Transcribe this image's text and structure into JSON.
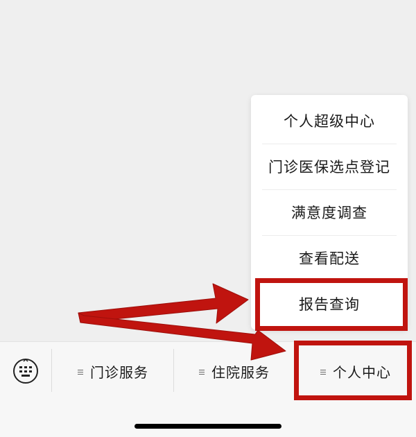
{
  "popup_menu": {
    "items": [
      {
        "label": "个人超级中心"
      },
      {
        "label": "门诊医保选点登记"
      },
      {
        "label": "满意度调查"
      },
      {
        "label": "查看配送"
      },
      {
        "label": "报告查询"
      }
    ]
  },
  "bottom_bar": {
    "keyboard_icon": "keyboard-icon",
    "tabs": [
      {
        "label": "门诊服务",
        "icon": "menu-lines-icon"
      },
      {
        "label": "住院服务",
        "icon": "menu-lines-icon"
      },
      {
        "label": "个人中心",
        "icon": "menu-lines-icon"
      }
    ]
  },
  "annotations": {
    "highlight_color": "#c0140f"
  }
}
